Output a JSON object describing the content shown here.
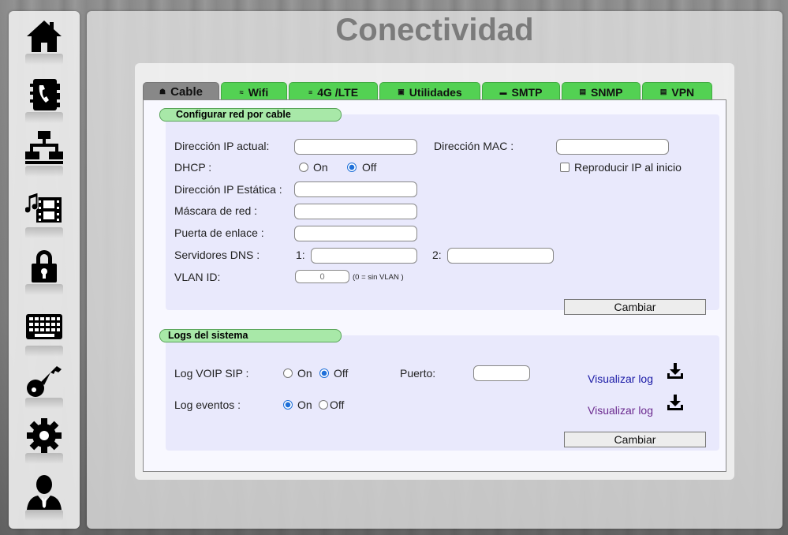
{
  "title": "Conectividad",
  "sidebar": {
    "items": [
      {
        "icon": "home-icon"
      },
      {
        "icon": "phonebook-icon"
      },
      {
        "icon": "network-icon"
      },
      {
        "icon": "media-icon"
      },
      {
        "icon": "lock-icon"
      },
      {
        "icon": "keyboard-icon"
      },
      {
        "icon": "key-icon"
      },
      {
        "icon": "gear-icon"
      },
      {
        "icon": "user-icon"
      }
    ]
  },
  "tabs": [
    {
      "label": "Cable",
      "icon": "☗",
      "active": true
    },
    {
      "label": "Wifi",
      "icon": "≈",
      "active": false
    },
    {
      "label": "4G /LTE",
      "icon": "≡",
      "active": false
    },
    {
      "label": "Utilidades",
      "icon": "▣",
      "active": false
    },
    {
      "label": "SMTP",
      "icon": "▬",
      "active": false
    },
    {
      "label": "SNMP",
      "icon": "▤",
      "active": false
    },
    {
      "label": "VPN",
      "icon": "▤",
      "active": false
    }
  ],
  "cable": {
    "section_title": "Configurar red por cable",
    "ip_actual_label": "Dirección IP actual:",
    "ip_actual_value": "",
    "mac_label": "Dirección MAC :",
    "mac_value": "",
    "dhcp_label": "DHCP :",
    "dhcp_on_label": "On",
    "dhcp_off_label": "Off",
    "dhcp_selected": "Off",
    "reproducir_label": "Reproducir IP al inicio",
    "reproducir_checked": false,
    "ip_estatica_label": "Dirección IP Estática :",
    "mascara_label": "Máscara de red :",
    "puerta_label": "Puerta de enlace :",
    "dns_label": "Servidores DNS :",
    "dns1_label": "1:",
    "dns2_label": "2:",
    "vlan_label": "VLAN ID:",
    "vlan_placeholder": "0",
    "vlan_hint": "(0 = sin VLAN )",
    "button": "Cambiar"
  },
  "logs": {
    "section_title": "Logs del sistema",
    "voip_label": "Log VOIP SIP :",
    "voip_on_label": "On",
    "voip_off_label": "Off",
    "voip_selected": "Off",
    "puerto_label": "Puerto:",
    "puerto_value": "",
    "eventos_label": "Log eventos :",
    "eventos_on_label": "On",
    "eventos_off_label": "Off",
    "eventos_selected": "On",
    "view_log_1": "Visualizar log",
    "view_log_2": "Visualizar log",
    "link_color": "#1a1aa6",
    "link_visited_color": "#6b2a8f",
    "button": "Cambiar"
  },
  "colors": {
    "tab_green": "#53d153",
    "tab_active": "#888888",
    "section_title_bg": "#a8e8a8",
    "radio_accent": "#1e6fd9"
  }
}
